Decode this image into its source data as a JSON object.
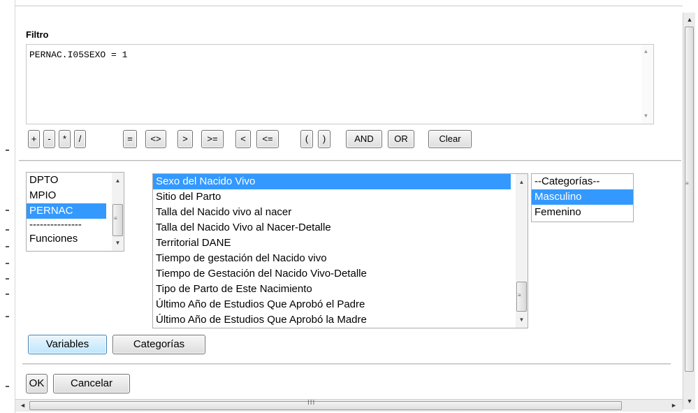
{
  "filter": {
    "label": "Filtro",
    "value": "PERNAC.I05SEXO = 1"
  },
  "operators": [
    "+",
    "-",
    "*",
    "/",
    "=",
    "<>",
    ">",
    ">=",
    "<",
    "<=",
    "(",
    ")",
    "AND",
    "OR",
    "Clear"
  ],
  "tables_list": {
    "items": [
      "DPTO",
      "MPIO",
      "PERNAC",
      "---------------",
      "Funciones"
    ],
    "selected": "PERNAC"
  },
  "variables_list": {
    "items": [
      "Sexo del Nacido Vivo",
      "Sitio del Parto",
      "Talla del Nacido vivo al nacer",
      "Talla del Nacido Vivo al Nacer-Detalle",
      "Territorial DANE",
      "Tiempo de gestación del Nacido vivo",
      "Tiempo de Gestación del Nacido Vivo-Detalle",
      "Tipo de Parto de Este Nacimiento",
      "Último Año de Estudios Que Aprobó el Padre",
      "Último Año de Estudios Que Aprobó la Madre"
    ],
    "selected": "Sexo del Nacido Vivo"
  },
  "categories_list": {
    "items": [
      "--Categorías--",
      "Masculino",
      "Femenino"
    ],
    "selected": "Masculino"
  },
  "buttons": {
    "variables": "Variables",
    "categorias": "Categorías",
    "ok": "OK",
    "cancelar": "Cancelar"
  },
  "scrollbar_grip": "III",
  "colors": {
    "selection": "#3399ff",
    "button_border": "#707070"
  }
}
